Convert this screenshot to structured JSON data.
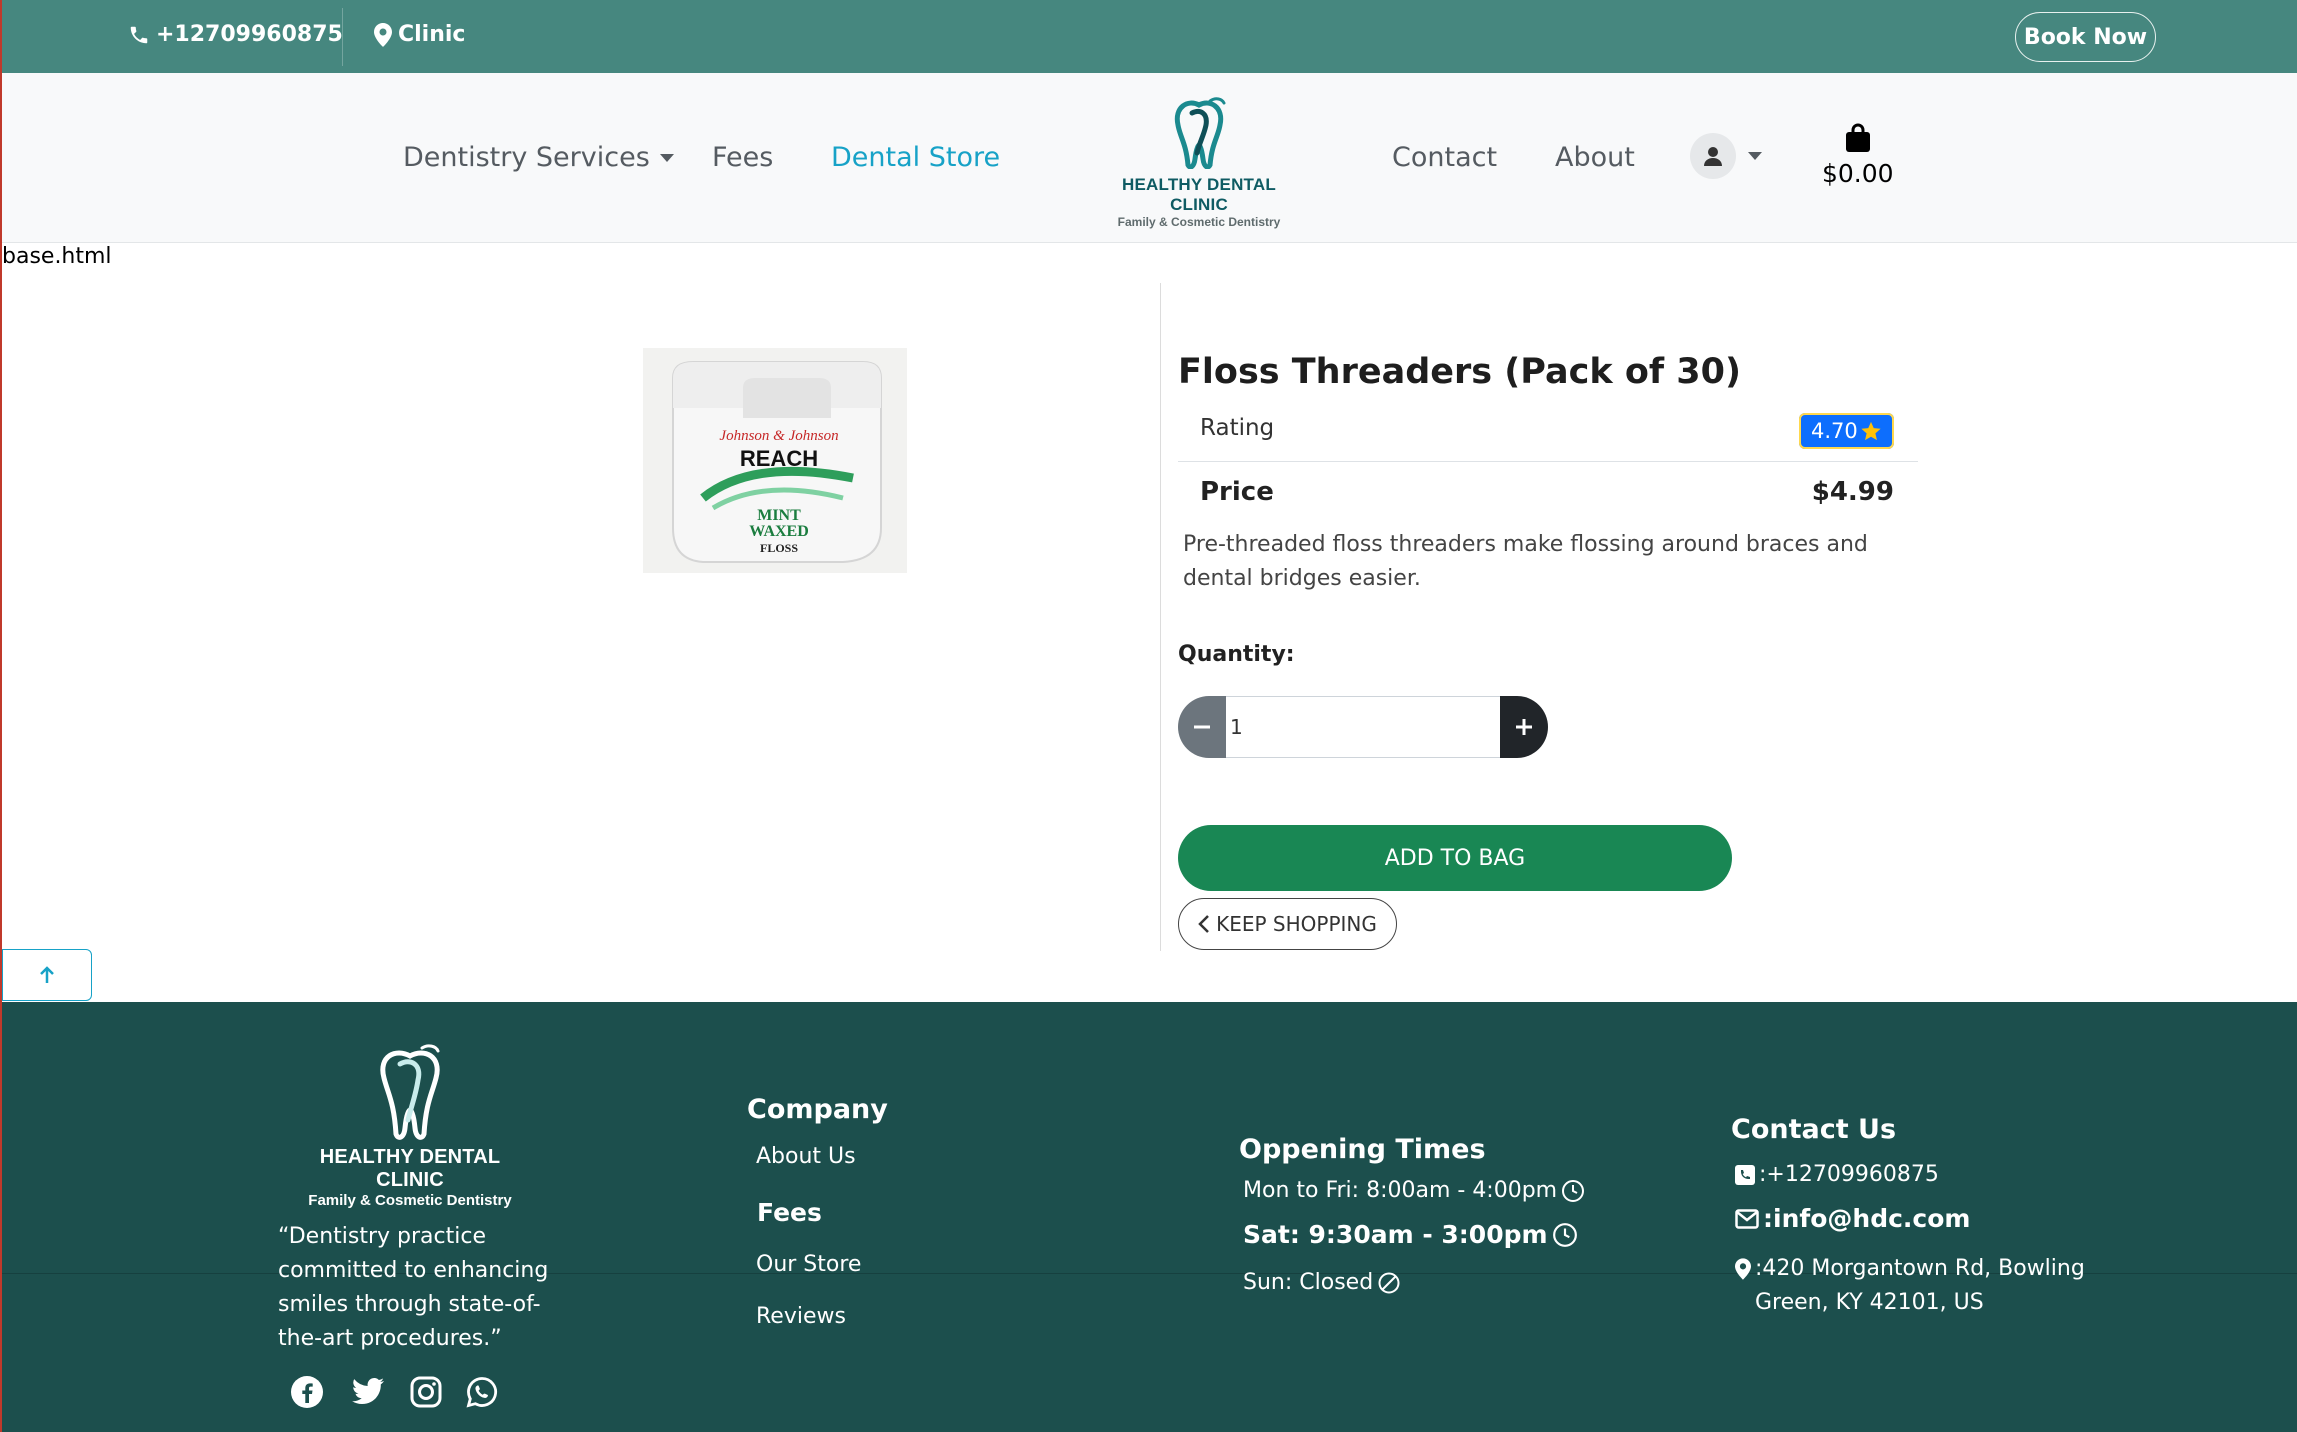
{
  "topbar": {
    "phone": "+12709960875",
    "location": "Clinic",
    "book_label": "Book Now"
  },
  "nav": {
    "services": "Dentistry Services",
    "fees": "Fees",
    "store": "Dental Store",
    "contact": "Contact",
    "about": "About",
    "bag_total": "$0.00"
  },
  "logo": {
    "name": "HEALTHY DENTAL CLINIC",
    "tagline": "Family & Cosmetic Dentistry"
  },
  "page_label": "base.html",
  "product": {
    "title": "Floss Threaders (Pack of 30)",
    "rating_label": "Rating",
    "rating_value": "4.70",
    "price_label": "Price",
    "price_value": "$4.99",
    "description": "Pre-threaded floss threaders make flossing around braces and dental bridges easier.",
    "quantity_label": "Quantity:",
    "quantity_value": "1",
    "image_text": {
      "brand": "Johnson & Johnson",
      "product": "REACH",
      "line1": "MINT",
      "line2": "WAXED",
      "line3": "FLOSS"
    },
    "add_label": "ADD TO BAG",
    "keep_label": "KEEP SHOPPING"
  },
  "footer": {
    "logo_name": "HEALTHY DENTAL CLINIC",
    "logo_tagline": "Family & Cosmetic Dentistry",
    "quote": "“Dentistry practice committed to enhancing smiles through state-of-the-art procedures.”",
    "company_heading": "Company",
    "about_us": "About Us",
    "fees": "Fees",
    "our_store": "Our Store",
    "reviews": "Reviews",
    "hours_heading": "Oppening Times",
    "weekday": "Mon to Fri: 8:00am - 4:00pm",
    "saturday": "Sat: 9:30am - 3:00pm",
    "sunday": "Sun: Closed",
    "contact_heading": "Contact Us",
    "phone": ":+12709960875",
    "email": ":info@hdc.com",
    "address": ":420 Morgantown Rd, Bowling Green, KY 42101, US"
  },
  "colors": {
    "topbar": "#46877f",
    "accent": "#17a2c7",
    "footer": "#1c4f4d",
    "add_button": "#198754",
    "rating_badge": "#0d6efd"
  }
}
